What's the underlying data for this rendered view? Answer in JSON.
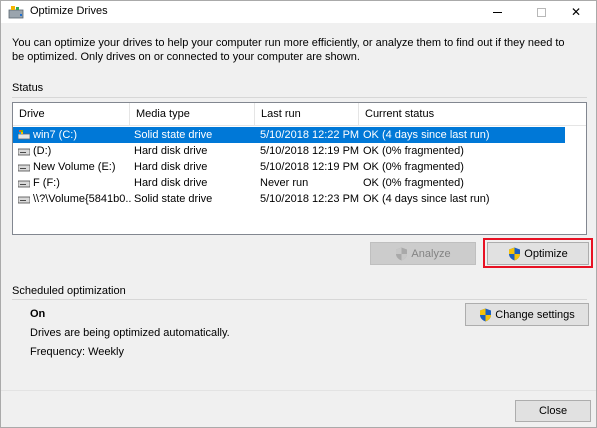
{
  "window": {
    "title": "Optimize Drives",
    "close_glyph": "✕"
  },
  "intro_text": "You can optimize your drives to help your computer run more efficiently, or analyze them to find out if they need to be optimized. Only drives on or connected to your computer are shown.",
  "status_section": {
    "label": "Status",
    "columns": [
      "Drive",
      "Media type",
      "Last run",
      "Current status"
    ],
    "rows": [
      {
        "drive": "win7 (C:)",
        "media": "Solid state drive",
        "last_run": "5/10/2018 12:22 PM",
        "status": "OK (4 days since last run)",
        "icon": "system-drive-icon",
        "selected": true
      },
      {
        "drive": "(D:)",
        "media": "Hard disk drive",
        "last_run": "5/10/2018 12:19 PM",
        "status": "OK (0% fragmented)",
        "icon": "drive-icon",
        "selected": false
      },
      {
        "drive": "New Volume (E:)",
        "media": "Hard disk drive",
        "last_run": "5/10/2018 12:19 PM",
        "status": "OK (0% fragmented)",
        "icon": "drive-icon",
        "selected": false
      },
      {
        "drive": "F (F:)",
        "media": "Hard disk drive",
        "last_run": "Never run",
        "status": "OK (0% fragmented)",
        "icon": "drive-icon",
        "selected": false
      },
      {
        "drive": "\\\\?\\Volume{5841b0...",
        "media": "Solid state drive",
        "last_run": "5/10/2018 12:23 PM",
        "status": "OK (4 days since last run)",
        "icon": "drive-icon",
        "selected": false
      }
    ],
    "analyze_label": "Analyze",
    "optimize_label": "Optimize"
  },
  "scheduled_section": {
    "label": "Scheduled optimization",
    "state": "On",
    "description": "Drives are being optimized automatically.",
    "frequency": "Frequency: Weekly",
    "change_settings_label": "Change settings"
  },
  "close_label": "Close",
  "colors": {
    "selection": "#0078d7",
    "highlight_border": "#e81123",
    "window_bg": "#f0f0f0"
  }
}
